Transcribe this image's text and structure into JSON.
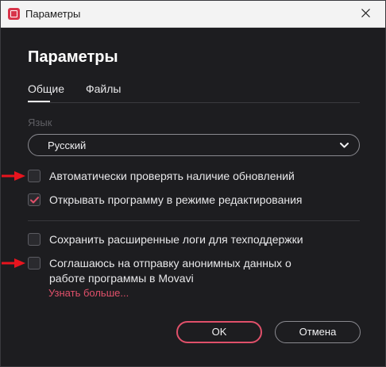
{
  "window": {
    "title": "Параметры",
    "close_icon": "close-icon",
    "app_icon": "movavi-app-icon"
  },
  "page": {
    "heading": "Параметры"
  },
  "tabs": [
    {
      "label": "Общие",
      "active": true
    },
    {
      "label": "Файлы",
      "active": false
    }
  ],
  "language": {
    "label": "Язык",
    "selected": "Русский",
    "icon": "chevron-down-icon"
  },
  "options": [
    {
      "label": "Автоматически проверять наличие обновлений",
      "checked": false
    },
    {
      "label": "Открывать программу в режиме редактирования",
      "checked": true
    },
    {
      "label": "Сохранить расширенные логи для техподдержки",
      "checked": false
    },
    {
      "label_line1": "Соглашаюсь на отправку анонимных данных о",
      "label_line2": "работе программы в Movavi",
      "checked": false
    }
  ],
  "learn_more": "Узнать больше...",
  "buttons": {
    "ok": "OK",
    "cancel": "Отмена"
  },
  "colors": {
    "accent": "#e0506a",
    "background": "#1d1d20",
    "annotation_arrow": "#e8141e"
  }
}
